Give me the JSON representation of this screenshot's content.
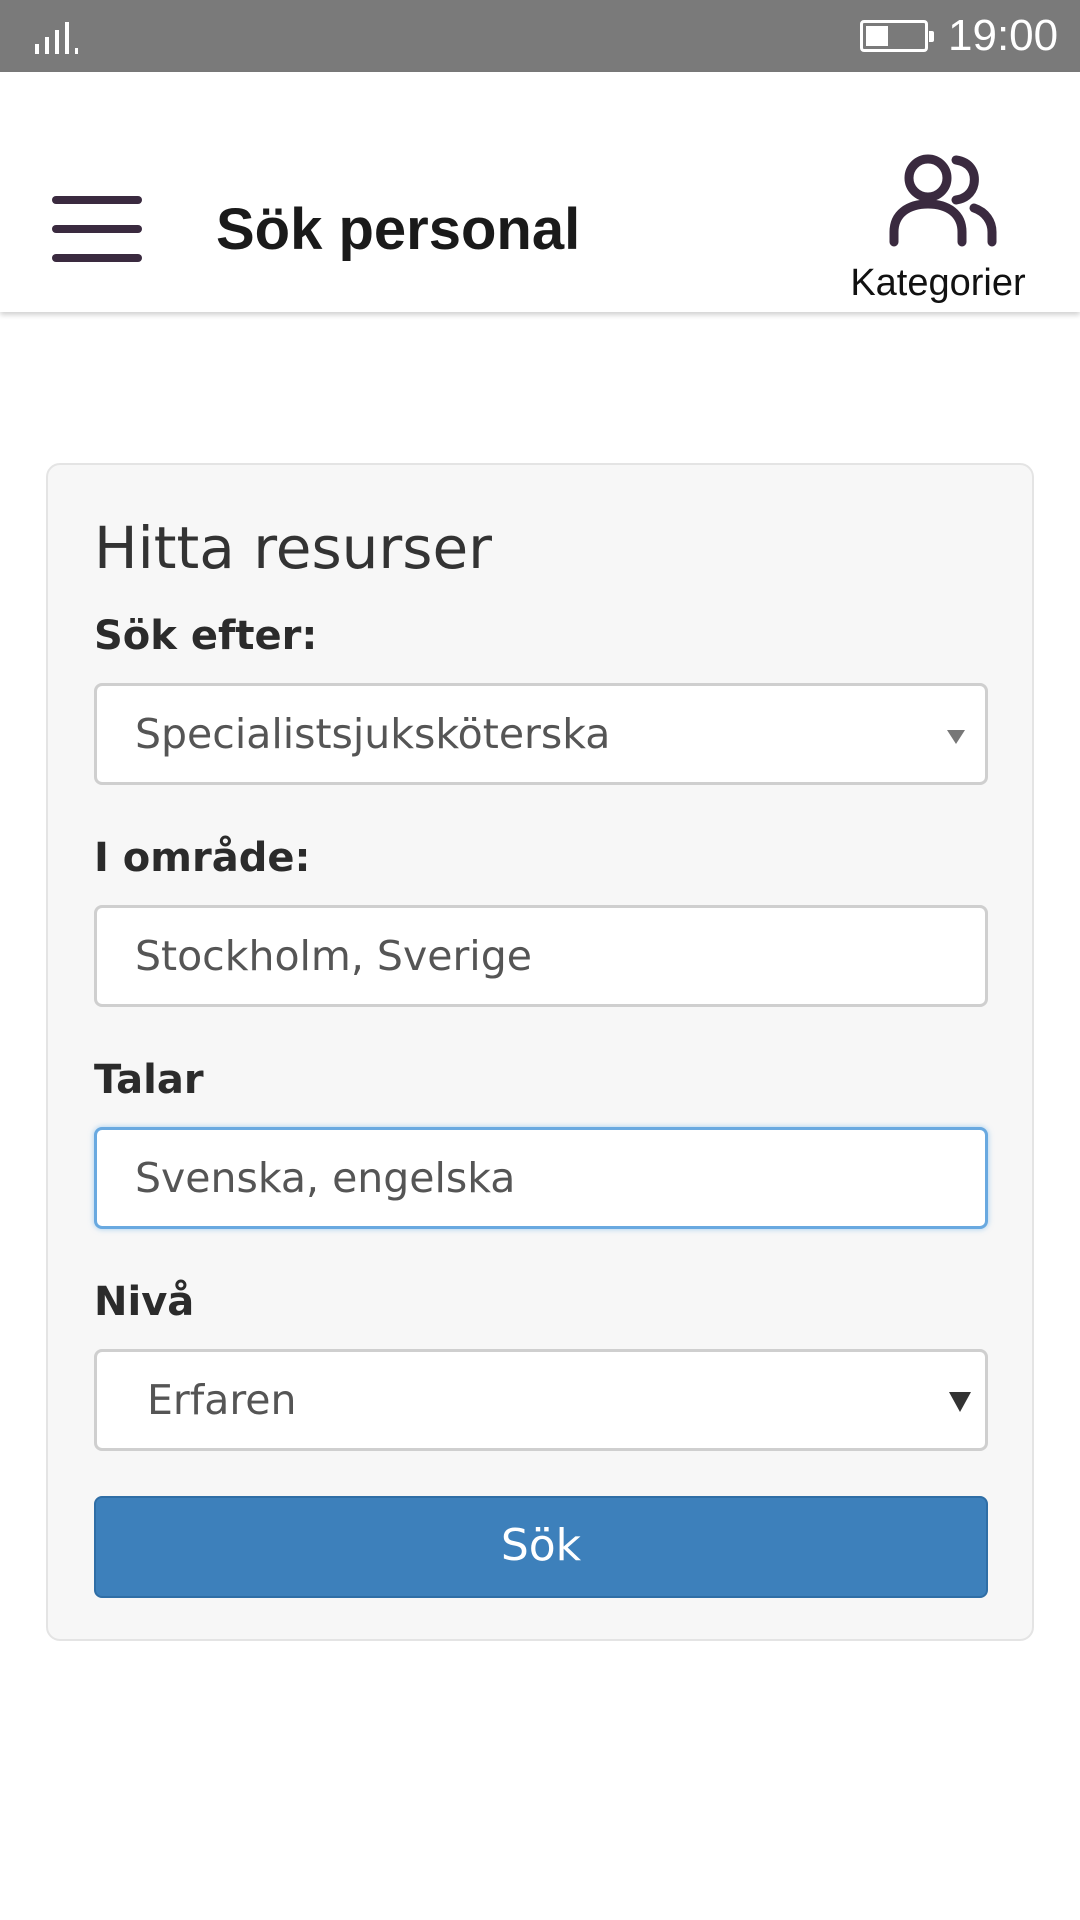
{
  "status_bar": {
    "time": "19:00",
    "battery_level": 0.4,
    "icons": [
      "signal-icon",
      "battery-icon"
    ]
  },
  "app_bar": {
    "title": "Sök personal",
    "categories_label": "Kategorier",
    "icons": [
      "menu-icon",
      "people-icon"
    ],
    "accent_color": "#3a2a3f"
  },
  "form": {
    "title": "Hitta resurser",
    "search_for": {
      "label": "Sök efter:",
      "value": "Specialistsjuksköterska"
    },
    "area": {
      "label": "I område:",
      "value": "Stockholm, Sverige"
    },
    "speaks": {
      "label": "Talar",
      "value": "Svenska, engelska"
    },
    "level": {
      "label": "Nivå",
      "value": "Erfaren"
    },
    "search_button": "Sök",
    "button_color": "#3d80bb"
  }
}
